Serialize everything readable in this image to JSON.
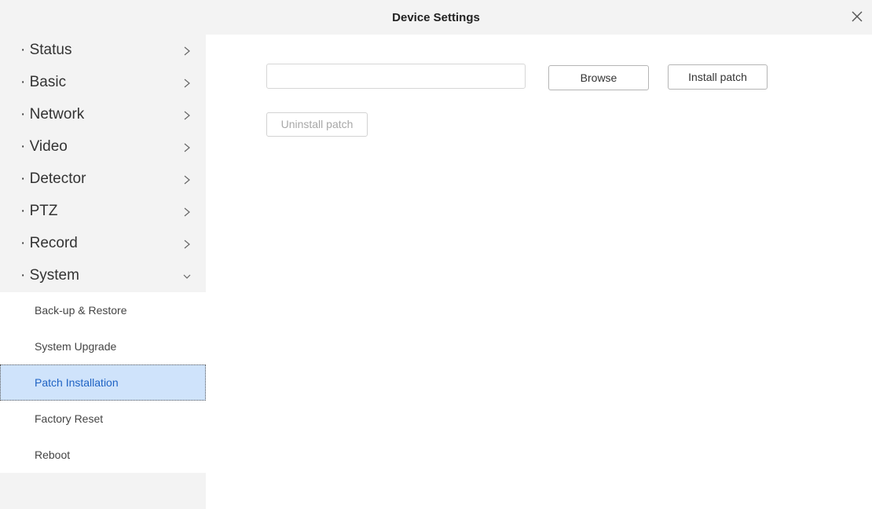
{
  "window": {
    "title": "Device Settings",
    "close_icon": "close-icon"
  },
  "sidebar": {
    "items": [
      {
        "label": "· Status",
        "chevron": "chevron-right-icon",
        "expanded": false
      },
      {
        "label": "· Basic",
        "chevron": "chevron-right-icon",
        "expanded": false
      },
      {
        "label": "· Network",
        "chevron": "chevron-right-icon",
        "expanded": false
      },
      {
        "label": "· Video",
        "chevron": "chevron-right-icon",
        "expanded": false
      },
      {
        "label": "· Detector",
        "chevron": "chevron-right-icon",
        "expanded": false
      },
      {
        "label": "· PTZ",
        "chevron": "chevron-right-icon",
        "expanded": false
      },
      {
        "label": "· Record",
        "chevron": "chevron-right-icon",
        "expanded": false
      },
      {
        "label": "· System",
        "chevron": "chevron-down-icon",
        "expanded": true
      }
    ],
    "system_subitems": [
      {
        "label": "Back-up & Restore",
        "active": false
      },
      {
        "label": "System Upgrade",
        "active": false
      },
      {
        "label": "Patch Installation",
        "active": true
      },
      {
        "label": "Factory Reset",
        "active": false
      },
      {
        "label": "Reboot",
        "active": false
      }
    ],
    "active_color": "#cfe3fb"
  },
  "patch": {
    "file_value": "",
    "browse_label": "Browse",
    "install_label": "Install patch",
    "uninstall_label": "Uninstall patch",
    "uninstall_enabled": false
  }
}
